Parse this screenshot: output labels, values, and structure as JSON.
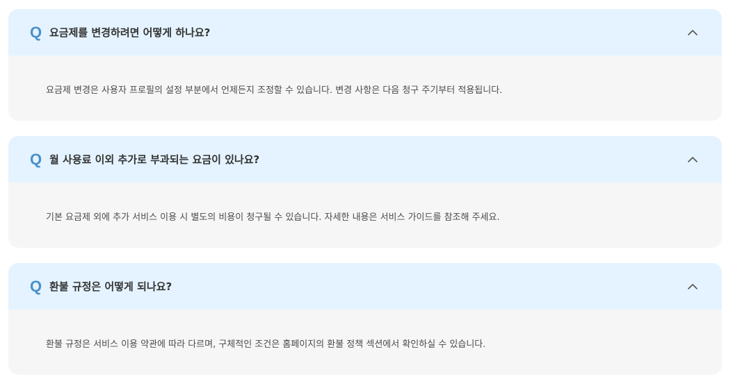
{
  "faq": {
    "question_marker": "Q",
    "items": [
      {
        "question": "요금제를 변경하려면 어떻게 하나요?",
        "answer": "요금제 변경은 사용자 프로필의 설정 부분에서 언제든지 조정할 수 있습니다. 변경 사항은 다음 청구 주기부터 적용됩니다.",
        "expanded": true
      },
      {
        "question": "월 사용료 이외 추가로 부과되는 요금이 있나요?",
        "answer": "기본 요금제 외에 추가 서비스 이용 시 별도의 비용이 청구될 수 있습니다. 자세한 내용은 서비스 가이드를 참조해 주세요.",
        "expanded": true
      },
      {
        "question": "환불 규정은 어떻게 되나요?",
        "answer": "환불 규정은 서비스 이용 약관에 따라 다르며, 구체적인 조건은 홈페이지의 환불 정책 섹션에서 확인하실 수 있습니다.",
        "expanded": true
      }
    ],
    "icons": {
      "toggle": "chevron-up-icon"
    },
    "colors": {
      "question_bg": "#e4f3ff",
      "answer_bg": "#f6f6f6",
      "marker": "#4a90c9"
    }
  }
}
